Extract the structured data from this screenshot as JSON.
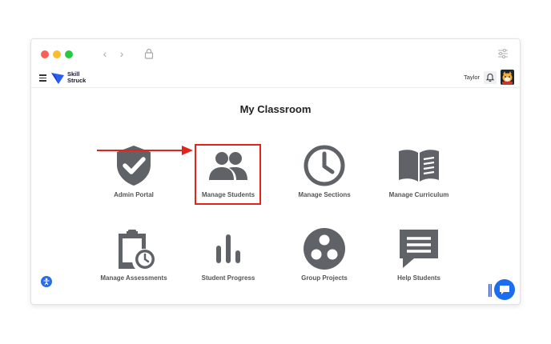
{
  "topbar": {
    "logo_line1": "Skill",
    "logo_line2": "Struck",
    "user_name": "Taylor"
  },
  "main": {
    "title": "My Classroom",
    "tiles": [
      {
        "label": "Admin Portal",
        "icon": "shield-check-icon"
      },
      {
        "label": "Manage Students",
        "icon": "people-icon"
      },
      {
        "label": "Manage Sections",
        "icon": "clock-icon"
      },
      {
        "label": "Manage Curriculum",
        "icon": "open-book-icon"
      },
      {
        "label": "Manage Assessments",
        "icon": "clipboard-clock-icon"
      },
      {
        "label": "Student Progress",
        "icon": "bar-chart-icon"
      },
      {
        "label": "Group Projects",
        "icon": "group-circles-icon"
      },
      {
        "label": "Help Students",
        "icon": "chat-bubble-icon"
      }
    ]
  },
  "colors": {
    "icon_gray": "#5f6368",
    "highlight_red": "#e2241b",
    "brand_blue": "#1c6cf0"
  }
}
